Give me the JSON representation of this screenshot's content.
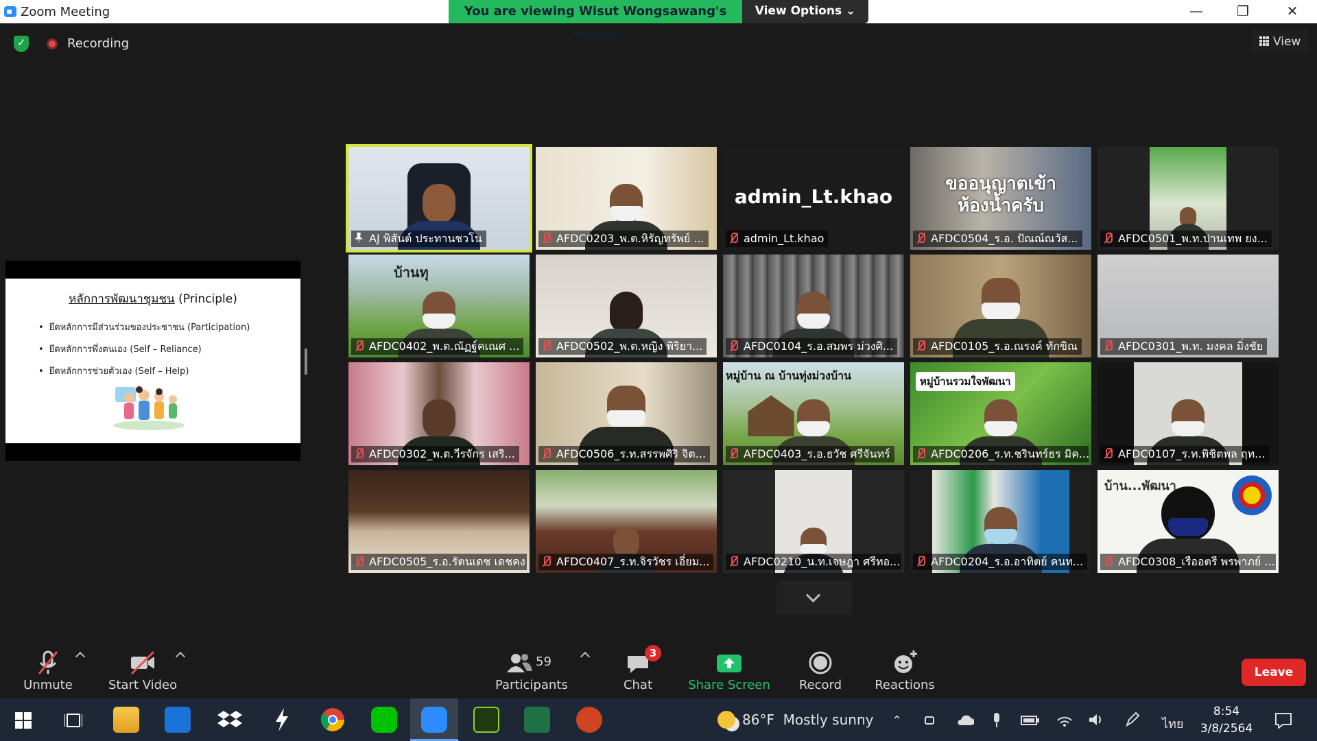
{
  "window": {
    "title": "Zoom Meeting",
    "viewing_banner": "You are viewing Wisut Wongsawang's screen",
    "view_options": "View Options ⌄",
    "minimize": "—",
    "restore": "❐",
    "close": "✕"
  },
  "status": {
    "recording": "Recording",
    "view": "View"
  },
  "shared_slide": {
    "title_thai": "หลักการพัฒนาชุมชน",
    "title_en": "(Principle)",
    "bullets": [
      "ยึดหลักการมีส่วนร่วมของประชาชน (Participation)",
      "ยึดหลักการพึ่งตนเอง (Self – Reliance)",
      "ยึดหลักการช่วยตัวเอง (Self – Help)"
    ]
  },
  "participants": [
    {
      "name": "AJ พิสันต์ ประทานชวโน",
      "muted": false,
      "active": true
    },
    {
      "name": "AFDC0203_พ.ต.หิรัญทรัพย์ ...",
      "muted": true
    },
    {
      "name": "admin_Lt.khao",
      "muted": true,
      "video_off_label": "admin_Lt.khao"
    },
    {
      "name": "AFDC0504_ร.อ. ปัณณ์ณวัส...",
      "muted": true,
      "overlay_text": "ขออนุญาตเข้าห้องน้ำครับ"
    },
    {
      "name": "AFDC0501_พ.ท.ปานเทพ ยง...",
      "muted": true
    },
    {
      "name": "AFDC0402_พ.ต.ณัฏฐ์คเณศ ...",
      "muted": true,
      "overlay_text": "บ้านทุ"
    },
    {
      "name": "AFDC0502_พ.ต.หญิง พิริยา...",
      "muted": true
    },
    {
      "name": "AFDC0104_ร.อ.สมพร ม่วงศิ...",
      "muted": true
    },
    {
      "name": "AFDC0105_ร.อ.ณรงค์ ทักขิณ",
      "muted": true
    },
    {
      "name": "AFDC0301_พ.ท. มงคล มิ่งชัย",
      "muted": true
    },
    {
      "name": "AFDC0302_พ.ต.วีรจักร เสริ...",
      "muted": true
    },
    {
      "name": "AFDC0506_ร.ท.สรรพศิริ จิต...",
      "muted": true
    },
    {
      "name": "AFDC0403_ร.อ.ธวัช ศรีจันทร์",
      "muted": true,
      "overlay_text": "หมู่บ้าน ณ บ้านทุ่งม่วงบ้าน"
    },
    {
      "name": "AFDC0206_ร.ท.ชรินทร์ธร มิค...",
      "muted": true,
      "overlay_text": "หมู่บ้านรวมใจพัฒนา"
    },
    {
      "name": "AFDC0107_ร.ท.พิชิตพล ฤท...",
      "muted": true
    },
    {
      "name": "AFDC0505_ร.อ.รัตนเดช เดชคง",
      "muted": true
    },
    {
      "name": "AFDC0407_ร.ท.จิรวัชร เอี่ยม...",
      "muted": true
    },
    {
      "name": "AFDC0210_น.ท.เจษฎา ศรีทอ...",
      "muted": true
    },
    {
      "name": "AFDC0204_ร.อ.อาทิตย์ คนท...",
      "muted": true
    },
    {
      "name": "AFDC0308_เรืออตรี พรพาภย์ ...",
      "muted": true,
      "overlay_text": "บ้าน...พัฒนา"
    }
  ],
  "toolbar": {
    "unmute": "Unmute",
    "start_video": "Start Video",
    "participants_label": "Participants",
    "participants_count": "59",
    "chat": "Chat",
    "chat_badge": "3",
    "share_screen": "Share Screen",
    "record": "Record",
    "reactions": "Reactions",
    "leave": "Leave"
  },
  "taskbar": {
    "weather_temp": "86°F",
    "weather_text": "Mostly sunny",
    "language": "ไทย",
    "time": "8:54",
    "date": "3/8/2564"
  },
  "colors": {
    "zoom_blue": "#2D8CFF",
    "banner_green": "#23b95c",
    "leave_red": "#e02828",
    "active_speaker": "#d5e636",
    "muted_red": "#e45050"
  }
}
